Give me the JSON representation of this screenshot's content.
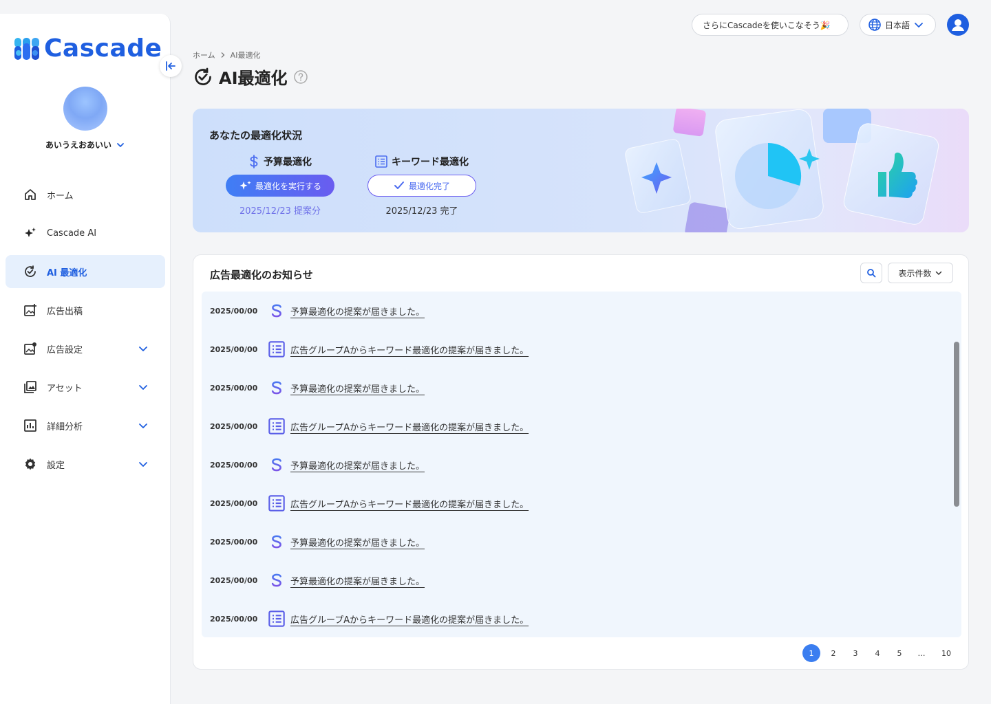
{
  "brand": {
    "name": "Cascade",
    "accent": "#1f5fe0"
  },
  "user": {
    "name": "あいうえおあいい"
  },
  "sidebar": {
    "items": [
      {
        "label": "ホーム",
        "icon": "home-icon",
        "active": false,
        "expandable": false
      },
      {
        "label": "Cascade AI",
        "icon": "sparkle-icon",
        "active": false,
        "expandable": false
      },
      {
        "label": "AI 最適化",
        "icon": "ai-optimize-icon",
        "active": true,
        "expandable": false
      },
      {
        "label": "広告出稿",
        "icon": "ad-publish-icon",
        "active": false,
        "expandable": false
      },
      {
        "label": "広告設定",
        "icon": "ad-settings-icon",
        "active": false,
        "expandable": true
      },
      {
        "label": "アセット",
        "icon": "image-gallery-icon",
        "active": false,
        "expandable": true
      },
      {
        "label": "詳細分析",
        "icon": "bar-chart-icon",
        "active": false,
        "expandable": true
      },
      {
        "label": "設定",
        "icon": "gear-icon",
        "active": false,
        "expandable": true
      }
    ]
  },
  "topbar": {
    "promo_label": "さらにCascadeを使いこなそう🎉",
    "language_label": "日本語"
  },
  "breadcrumb": {
    "home": "ホーム",
    "current": "AI最適化"
  },
  "page": {
    "title": "AI最適化"
  },
  "status": {
    "title": "あなたの最適化状況",
    "budget": {
      "label": "予算最適化",
      "button_label": "最適化を実行する",
      "date_text": "2025/12/23 提案分"
    },
    "keyword": {
      "label": "キーワード最適化",
      "button_label": "最適化完了",
      "date_text": "2025/12/23 完了"
    }
  },
  "notices": {
    "title": "広告最適化のお知らせ",
    "count_label": "表示件数",
    "rows": [
      {
        "date": "2025/00/00",
        "type": "budget",
        "text": "予算最適化の提案が届きました。"
      },
      {
        "date": "2025/00/00",
        "type": "keyword",
        "text": "広告グループAからキーワード最適化の提案が届きました。"
      },
      {
        "date": "2025/00/00",
        "type": "budget",
        "text": "予算最適化の提案が届きました。"
      },
      {
        "date": "2025/00/00",
        "type": "keyword",
        "text": "広告グループAからキーワード最適化の提案が届きました。"
      },
      {
        "date": "2025/00/00",
        "type": "budget",
        "text": "予算最適化の提案が届きました。"
      },
      {
        "date": "2025/00/00",
        "type": "keyword",
        "text": "広告グループAからキーワード最適化の提案が届きました。"
      },
      {
        "date": "2025/00/00",
        "type": "budget",
        "text": "予算最適化の提案が届きました。"
      },
      {
        "date": "2025/00/00",
        "type": "budget",
        "text": "予算最適化の提案が届きました。"
      },
      {
        "date": "2025/00/00",
        "type": "keyword",
        "text": "広告グループAからキーワード最適化の提案が届きました。"
      }
    ]
  },
  "pagination": {
    "pages": [
      "1",
      "2",
      "3",
      "4",
      "5",
      "…",
      "10"
    ],
    "current": "1"
  }
}
